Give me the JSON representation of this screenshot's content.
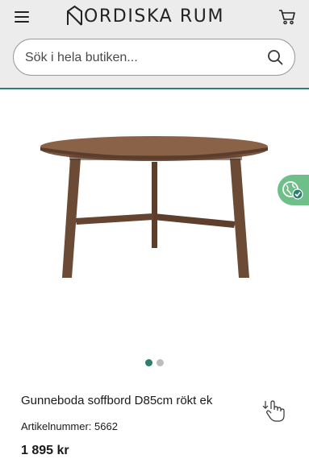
{
  "header": {
    "brand": "NORDISKA RUM",
    "brand_rest": "ORDISKA RUM",
    "menu_icon": "hamburger-menu-icon",
    "cart_icon": "shopping-cart-icon"
  },
  "search": {
    "placeholder": "Sök i hela butiken...",
    "value": "",
    "icon": "search-icon"
  },
  "product": {
    "image_subject": "round-walnut-coffee-table",
    "title": "Gunneboda soffbord D85cm rökt ek",
    "article_label": "Artikelnummer: 5662",
    "price": "1 895 kr"
  },
  "carousel": {
    "total_images": 2,
    "active_index": 0
  },
  "colors": {
    "accent": "#2f7d6e",
    "header_bg": "#ececec",
    "eco_badge": "#6fbf8a",
    "wood": "#6b4a36"
  }
}
